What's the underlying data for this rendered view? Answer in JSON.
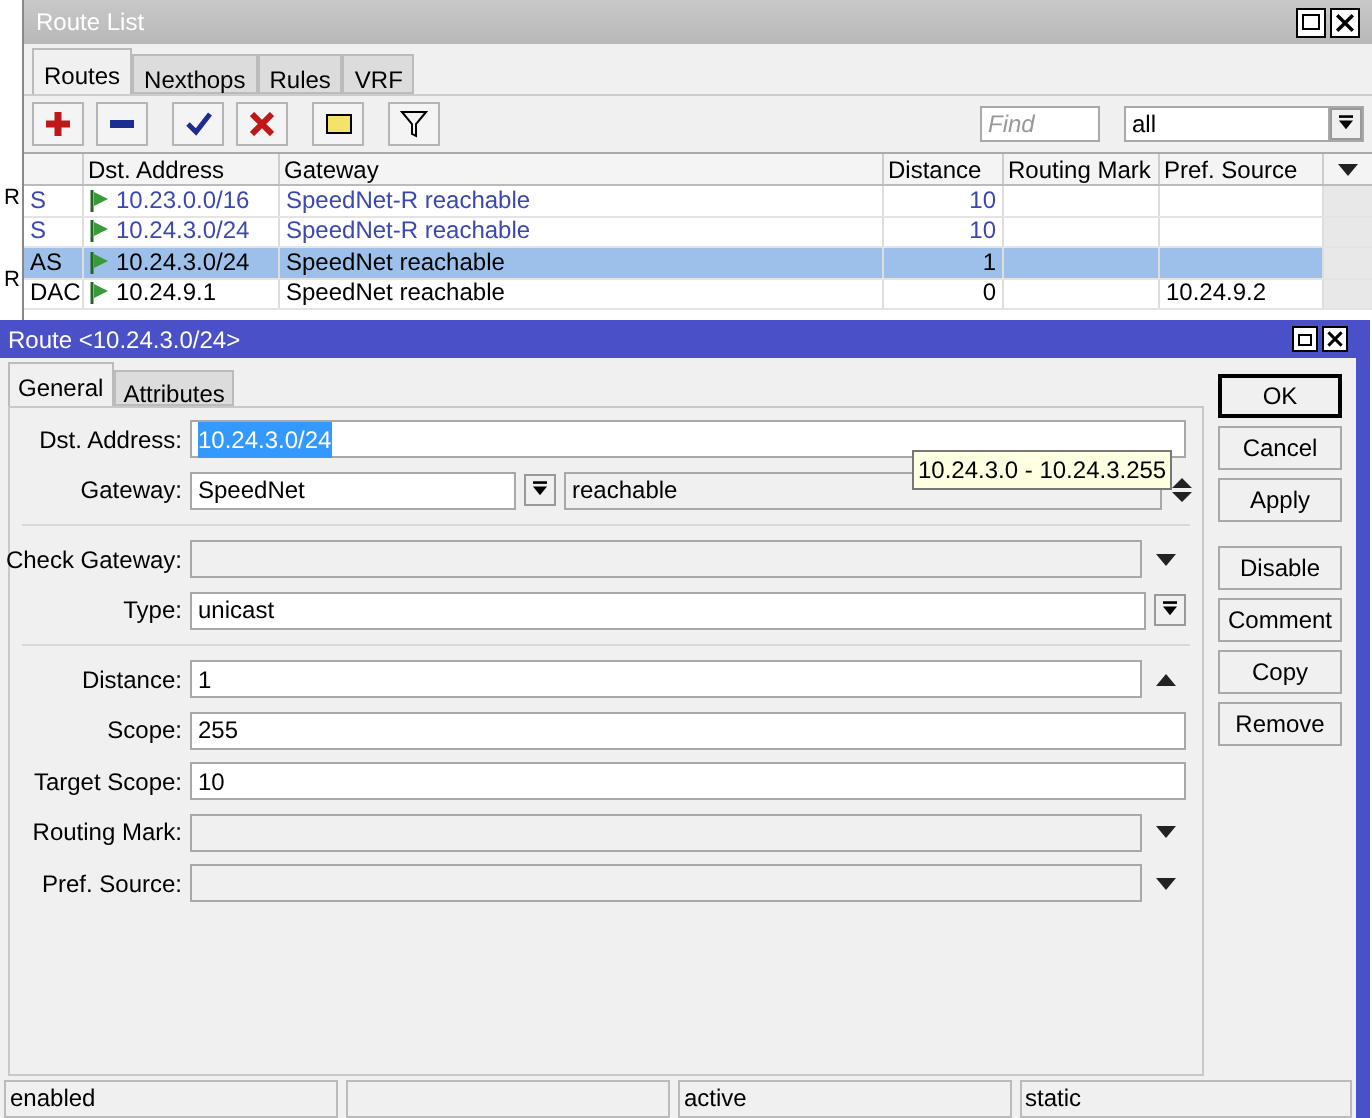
{
  "background_window": {
    "row_marks": [
      "R",
      "R"
    ]
  },
  "route_list": {
    "title": "Route List",
    "tabs": [
      {
        "label": "Routes",
        "selected": true
      },
      {
        "label": "Nexthops",
        "selected": false
      },
      {
        "label": "Rules",
        "selected": false
      },
      {
        "label": "VRF",
        "selected": false
      }
    ],
    "find": {
      "placeholder": "Find"
    },
    "filter": {
      "value": "all"
    },
    "columns": [
      "",
      "Dst. Address",
      "Gateway",
      "Distance",
      "Routing Mark",
      "Pref. Source"
    ],
    "rows": [
      {
        "flags": "S",
        "dst": "10.23.0.0/16",
        "gateway": "SpeedNet-R reachable",
        "distance": "10",
        "active": false,
        "selected": false
      },
      {
        "flags": "S",
        "dst": "10.24.3.0/24",
        "gateway": "SpeedNet-R reachable",
        "distance": "10",
        "active": false,
        "selected": false
      },
      {
        "flags": "AS",
        "dst": "10.24.3.0/24",
        "gateway": "SpeedNet reachable",
        "distance": "1",
        "active": true,
        "selected": true
      },
      {
        "flags": "DAC",
        "dst": "10.24.9.1",
        "gateway": "SpeedNet reachable",
        "distance": "0",
        "pref_source": "10.24.9.2",
        "active": true,
        "selected": false
      }
    ]
  },
  "route_dialog": {
    "title": "Route <10.24.3.0/24>",
    "tabs": [
      {
        "label": "General",
        "selected": true
      },
      {
        "label": "Attributes",
        "selected": false
      }
    ],
    "fields": [
      {
        "kind": "text",
        "label": "Dst. Address:",
        "value": "10.24.3.0/24",
        "disabled": false,
        "highlighted": true
      },
      {
        "kind": "gateway",
        "label": "Gateway:",
        "value": "SpeedNet",
        "status": "reachable",
        "disabled": false
      },
      {
        "kind": "separator"
      },
      {
        "kind": "dropdown",
        "label": "Check Gateway:",
        "disabled": true
      },
      {
        "kind": "combo",
        "label": "Type:",
        "value": "unicast",
        "disabled": false
      },
      {
        "kind": "separator"
      },
      {
        "kind": "spin",
        "label": "Distance:",
        "value": "1",
        "disabled": false
      },
      {
        "kind": "text",
        "label": "Scope:",
        "value": "255",
        "disabled": false
      },
      {
        "kind": "text",
        "label": "Target Scope:",
        "value": "10",
        "disabled": false
      },
      {
        "kind": "dropdown",
        "label": "Routing Mark:",
        "disabled": true
      },
      {
        "kind": "dropdown",
        "label": "Pref. Source:",
        "disabled": true
      }
    ],
    "tooltip": "10.24.3.0 - 10.24.3.255",
    "buttons": [
      {
        "label": "OK",
        "default": true
      },
      {
        "label": "Cancel",
        "default": false
      },
      {
        "label": "Apply",
        "default": false
      },
      {
        "label": "Disable",
        "default": false
      },
      {
        "label": "Comment",
        "default": false
      },
      {
        "label": "Copy",
        "default": false
      },
      {
        "label": "Remove",
        "default": false
      }
    ],
    "status_bar": [
      {
        "kind": "text",
        "text": "enabled"
      },
      {
        "kind": "empty"
      },
      {
        "kind": "text",
        "text": "active"
      },
      {
        "kind": "text",
        "text": "static"
      }
    ]
  }
}
